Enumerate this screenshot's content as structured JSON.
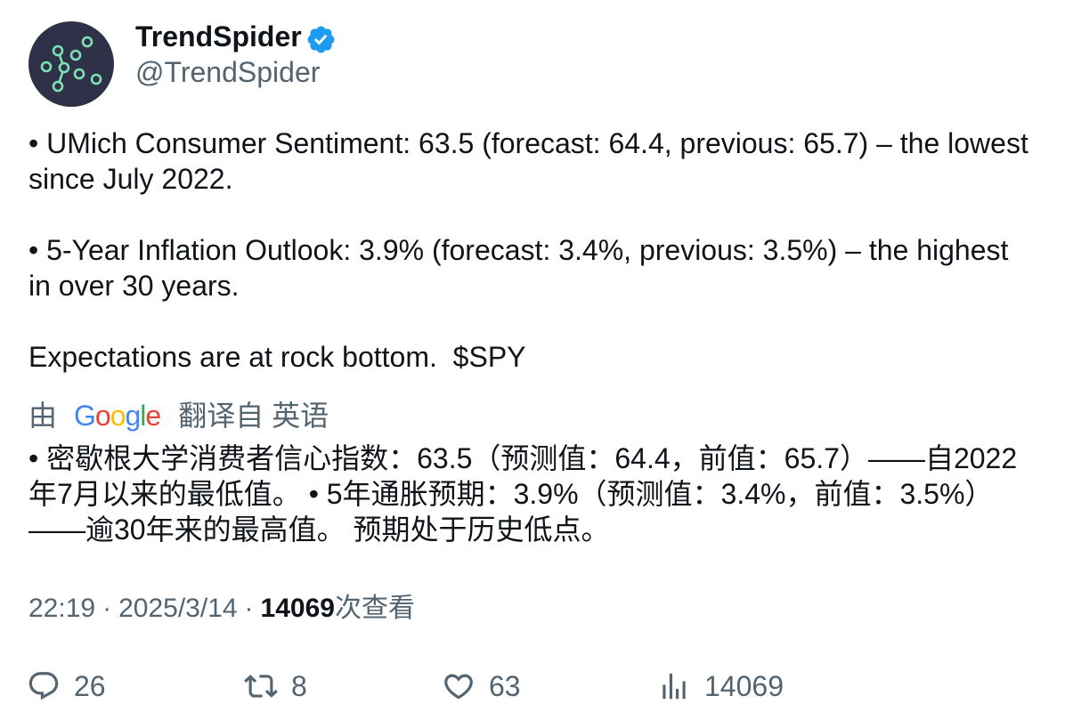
{
  "colors": {
    "text": "#0f1419",
    "secondary": "#536471",
    "verified": "#1d9bf0",
    "avatar_background": "#2e3148",
    "avatar_mark": "#7ee0b5"
  },
  "icons": {
    "verified": "verified-badge-icon",
    "reply": "reply-icon",
    "retweet": "retweet-icon",
    "like": "heart-icon",
    "views": "views-chart-icon"
  },
  "tweet": {
    "author": {
      "name": "TrendSpider",
      "handle": "@TrendSpider",
      "verified": true
    },
    "body": {
      "paragraphs": [
        "• UMich Consumer Sentiment: 63.5 (forecast: 64.4, previous: 65.7) – the lowest since July 2022.",
        "• 5-Year Inflation Outlook: 3.9% (forecast: 3.4%, previous: 3.5%) – the highest in over 30 years.",
        "Expectations are at rock bottom.  $SPY"
      ]
    },
    "translation": {
      "prefix": "由",
      "provider": "Google",
      "provider_colors": [
        "#4285F4",
        "#EA4335",
        "#FBBC05",
        "#4285F4",
        "#34A853",
        "#EA4335"
      ],
      "suffix": "翻译自 英语",
      "text": "• 密歇根大学消费者信心指数：63.5（预测值：64.4，前值：65.7）——自2022年7月以来的最低值。 • 5年通胀预期：3.9%（预测值：3.4%，前值：3.5%）——逾30年来的最高值。 预期处于历史低点。"
    },
    "meta": {
      "time": "22:19",
      "separator": "·",
      "date": "2025/3/14",
      "views_count": "14069",
      "views_label": "次查看"
    },
    "actions": {
      "replies": "26",
      "retweets": "8",
      "likes": "63",
      "views": "14069"
    }
  }
}
